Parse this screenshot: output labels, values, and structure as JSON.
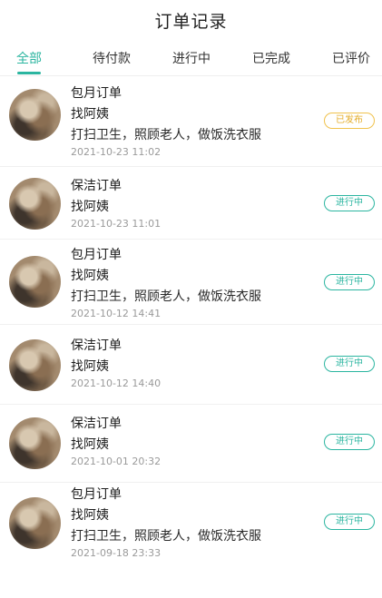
{
  "header": {
    "title": "订单记录"
  },
  "tabs": [
    {
      "label": "全部"
    },
    {
      "label": "待付款"
    },
    {
      "label": "进行中"
    },
    {
      "label": "已完成"
    },
    {
      "label": "已评价"
    }
  ],
  "orders": [
    {
      "type": "包月订单",
      "company": "找阿姨",
      "service": "打扫卫生，照顾老人，做饭洗衣服",
      "time": "2021-10-23 11:02",
      "status": "已发布"
    },
    {
      "type": "保洁订单",
      "company": "找阿姨",
      "service": "",
      "time": "2021-10-23 11:01",
      "status": "进行中"
    },
    {
      "type": "包月订单",
      "company": "找阿姨",
      "service": "打扫卫生，照顾老人，做饭洗衣服",
      "time": "2021-10-12 14:41",
      "status": "进行中"
    },
    {
      "type": "保洁订单",
      "company": "找阿姨",
      "service": "",
      "time": "2021-10-12 14:40",
      "status": "进行中"
    },
    {
      "type": "保洁订单",
      "company": "找阿姨",
      "service": "",
      "time": "2021-10-01 20:32",
      "status": "进行中"
    },
    {
      "type": "包月订单",
      "company": "找阿姨",
      "service": "打扫卫生，照顾老人，做饭洗衣服",
      "time": "2021-09-18 23:33",
      "status": "进行中"
    }
  ],
  "colors": {
    "accent": "#2bb5a0",
    "published": "#f0c24d"
  }
}
